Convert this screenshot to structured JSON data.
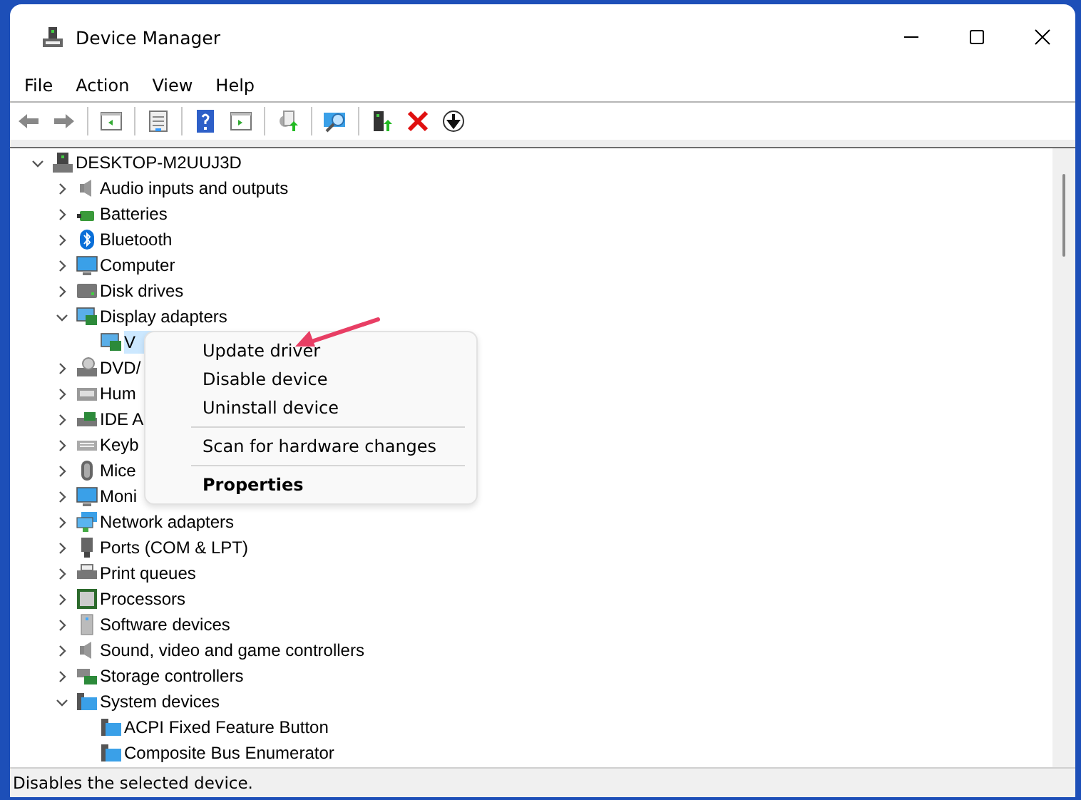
{
  "window": {
    "title": "Device Manager"
  },
  "menu_bar": [
    "File",
    "Action",
    "View",
    "Help"
  ],
  "tree": {
    "label": "DESKTOP-M2UUJ3D",
    "expanded": true,
    "children": [
      {
        "label": "Audio inputs and outputs",
        "expanded": false
      },
      {
        "label": "Batteries",
        "expanded": false
      },
      {
        "label": "Bluetooth",
        "expanded": false
      },
      {
        "label": "Computer",
        "expanded": false
      },
      {
        "label": "Disk drives",
        "expanded": false
      },
      {
        "label": "Display adapters",
        "expanded": true,
        "children": [
          {
            "label": "V",
            "selected": true
          }
        ]
      },
      {
        "label": "DVD/",
        "expanded": false
      },
      {
        "label": "Hum",
        "expanded": false
      },
      {
        "label": "IDE A",
        "expanded": false
      },
      {
        "label": "Keyb",
        "expanded": false
      },
      {
        "label": "Mice",
        "expanded": false
      },
      {
        "label": "Moni",
        "expanded": false
      },
      {
        "label": "Network adapters",
        "expanded": false
      },
      {
        "label": "Ports (COM & LPT)",
        "expanded": false
      },
      {
        "label": "Print queues",
        "expanded": false
      },
      {
        "label": "Processors",
        "expanded": false
      },
      {
        "label": "Software devices",
        "expanded": false
      },
      {
        "label": "Sound, video and game controllers",
        "expanded": false
      },
      {
        "label": "Storage controllers",
        "expanded": false
      },
      {
        "label": "System devices",
        "expanded": true,
        "children": [
          {
            "label": "ACPI Fixed Feature Button",
            "selected": false
          },
          {
            "label": "Composite Bus Enumerator",
            "selected": false
          }
        ]
      }
    ]
  },
  "context_menu": [
    {
      "label": "Update driver",
      "separator_before": false,
      "default": false
    },
    {
      "label": "Disable device",
      "separator_before": false,
      "default": false
    },
    {
      "label": "Uninstall device",
      "separator_before": false,
      "default": false
    },
    {
      "label": "Scan for hardware changes",
      "separator_before": true,
      "default": false
    },
    {
      "label": "Properties",
      "separator_before": true,
      "default": true
    }
  ],
  "status_bar": "Disables the selected device."
}
